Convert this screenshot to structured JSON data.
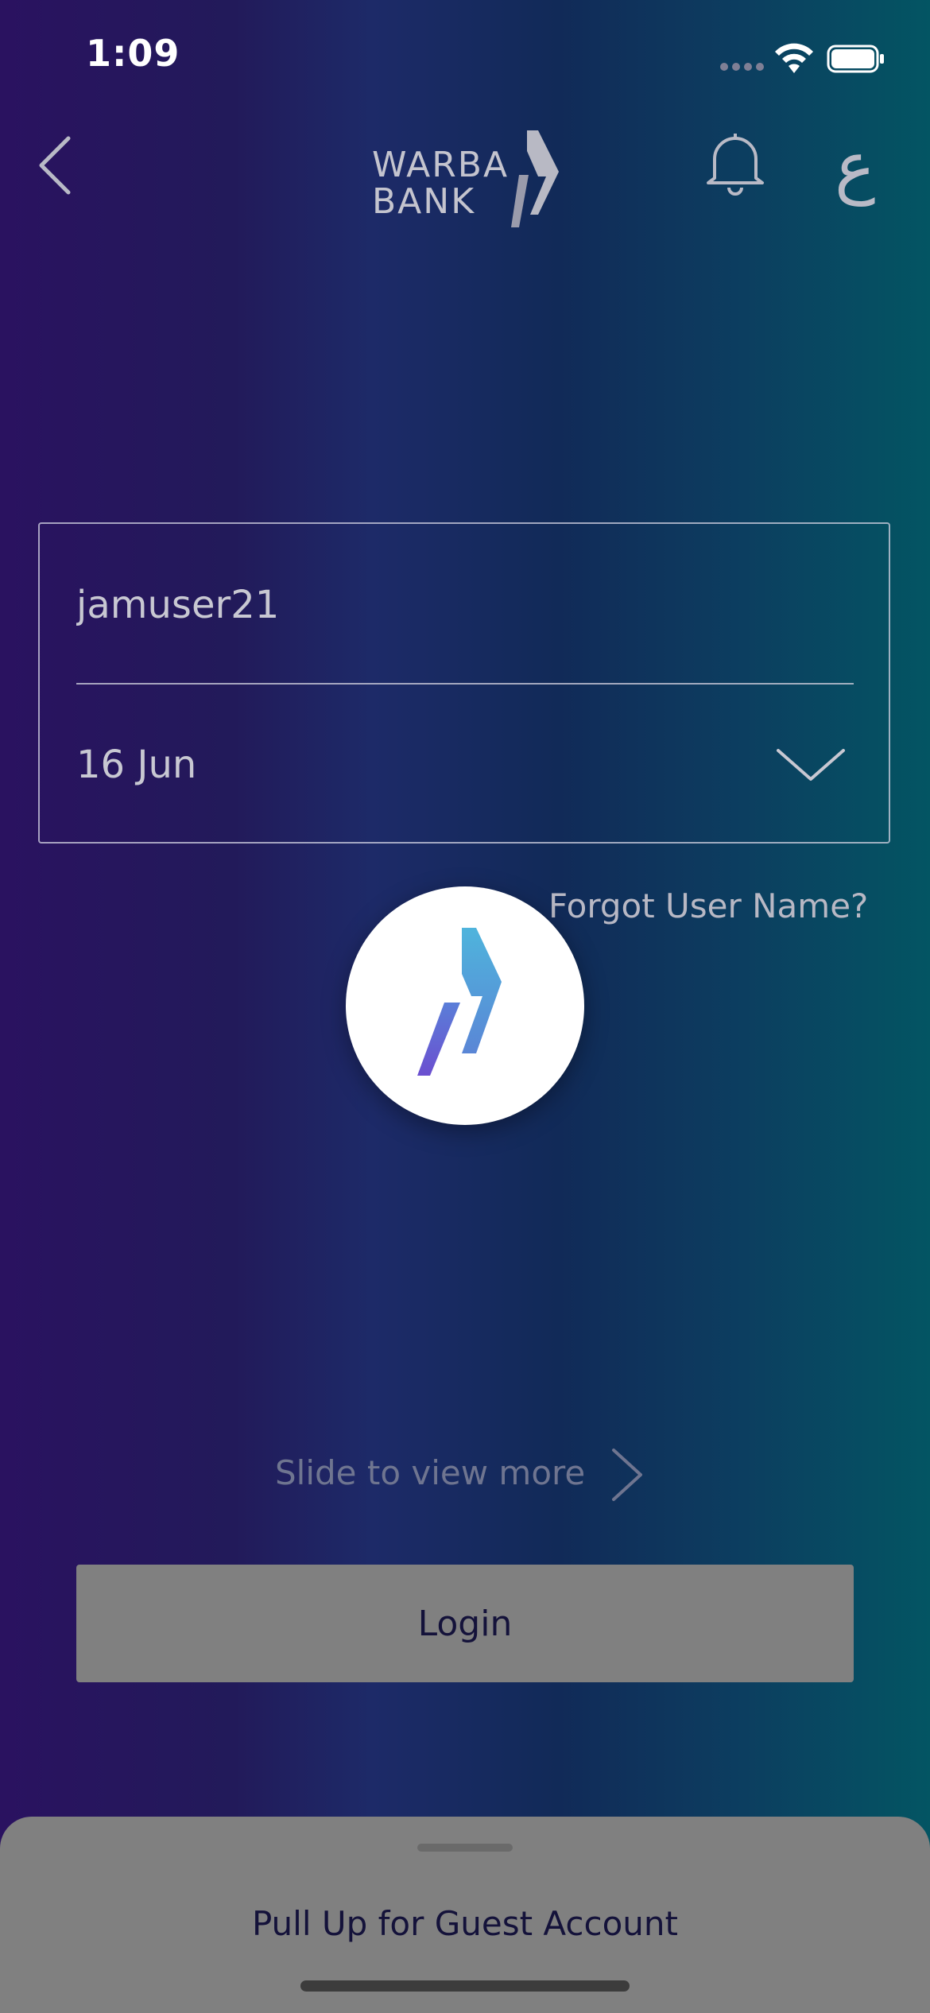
{
  "status_bar": {
    "time": "1:09",
    "icons": [
      "signal-icon",
      "wifi-icon",
      "battery-icon"
    ]
  },
  "nav": {
    "back_icon": "chevron-left-icon",
    "brand_line1": "WARBA",
    "brand_line2": "BANK",
    "bell_icon": "bell-icon",
    "language_toggle": "ع"
  },
  "login_form": {
    "username_value": "jamuser21",
    "date_value": "16 Jun",
    "date_icon": "chevron-down-icon"
  },
  "forgot_username": "Forgot User Name?",
  "slide_hint": "Slide to view more",
  "login_button": "Login",
  "guest_sheet": {
    "label": "Pull Up for Guest Account"
  },
  "colors": {
    "gradient_left": "#2a1260",
    "gradient_right": "#035563",
    "button_gray": "#808080",
    "button_text": "#14123a",
    "logo_blue": "#4fb4dc",
    "logo_purple": "#6b4fd0"
  }
}
